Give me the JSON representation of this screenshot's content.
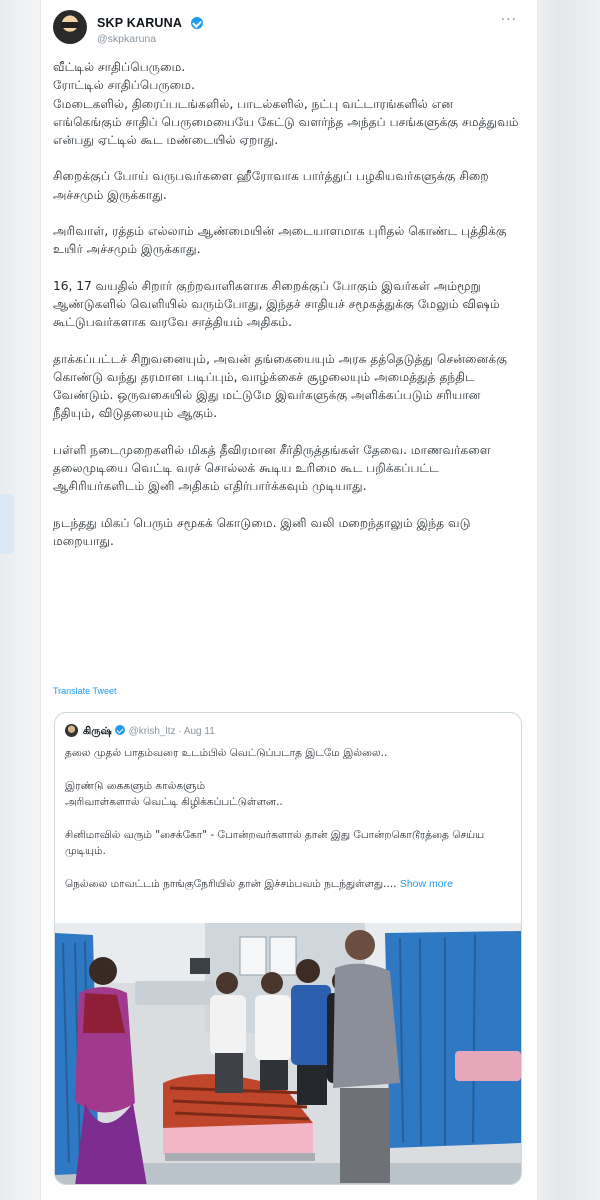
{
  "tweet": {
    "author_name": "SKP KARUNA",
    "author_handle": "@skpkaruna",
    "more_label": "···",
    "paragraphs": [
      "வீட்டில் சாதிப்பெருமை.\nரோட்டில் சாதிப்பெருமை.\nமேடைகளில், திரைப்படங்களில், பாடல்களில், நட்பு வட்டாரங்களில் என எங்கெங்கும் சாதிப் பெருமையையே கேட்டு வளர்ந்த அந்தப் பசங்களுக்கு சமத்துவம் என்பது ஏட்டில் கூட மண்டையில் ஏறாது.",
      "சிறைக்குப் போய் வருபவர்களை ஹீரோவாக பார்த்துப் பழகியவர்களுக்கு சிறை அச்சமும் இருக்காது.",
      "அரிவாள், ரத்தம் எல்லாம் ஆண்மையின் அடையாளமாக புரிதல் கொண்ட புத்திக்கு உயிர் அச்சமும் இருக்காது.",
      "16, 17 வயதில் சிறார் குற்றவாளிகளாக சிறைக்குப் போகும் இவர்கள் அம்மூறு ஆண்டுகளில் வெளியில் வரும்போது, இந்தச் சாதியச் சமூகத்துக்கு மேலும் விஷம் கூட்டுபவர்களாக வரவே சாத்தியம் அதிகம்.",
      "தாக்கப்பட்டச் சிறுவனையும், அவன் தங்கையையும் அரசு தத்தெடுத்து சென்னைக்கு கொண்டு வந்து தரமான படிப்பும், வாழ்க்கைச் சூழலையும் அமைத்துத் தந்திட வேண்டும். ஒருவகையில் இது மட்டுமே இவர்களுக்கு அளிக்கப்படும் சரியான நீதியும், விடுதலையும் ஆகும்.",
      "பள்ளி நடைமுறைகளில் மிகத் தீவிரமான சீர்திருத்தங்கள் தேவை. மாணவர்களை தலைமுடியை வெட்டி வரச் சொல்லக் கூடிய உரிமை கூட பறிக்கப்பட்ட ஆசிரியர்களிடம் இனி அதிகம் எதிர்பார்க்கவும் முடியாது.",
      "நடந்தது மிகப் பெரும் சமூகக் கொடுமை. இனி வலி மறைந்தாலும் இந்த வடு மறையாது."
    ],
    "translate_label": "Translate Tweet"
  },
  "quote": {
    "author_name": "கிருஷ்",
    "author_handle": "@krish_ltz",
    "separator": " · ",
    "date": "Aug 11",
    "paragraphs": [
      "தலை முதல் பாதம்வரை உடம்பில் வெட்டுப்படாத இடமே இல்லை..",
      "இரண்டு கைகளும் கால்களும்\nஅரிவாள்களால் வெட்டி கிழிக்கப்பட்டுள்ளன..",
      "சினிமாவில் வரும் \"சைக்கோ\" - போன்றவர்களால் தான் இது போன்றகொடூரத்தை செய்ய முடியும்."
    ],
    "last_paragraph": "நெல்லை மாவட்டம் நாங்குநேரியில் தான் இச்சம்பவம் நடந்துள்ளது....",
    "show_more_label": "Show more"
  },
  "colors": {
    "accent": "#1d9bf0",
    "text": "#23282c",
    "curtain": "#2f78c4"
  }
}
